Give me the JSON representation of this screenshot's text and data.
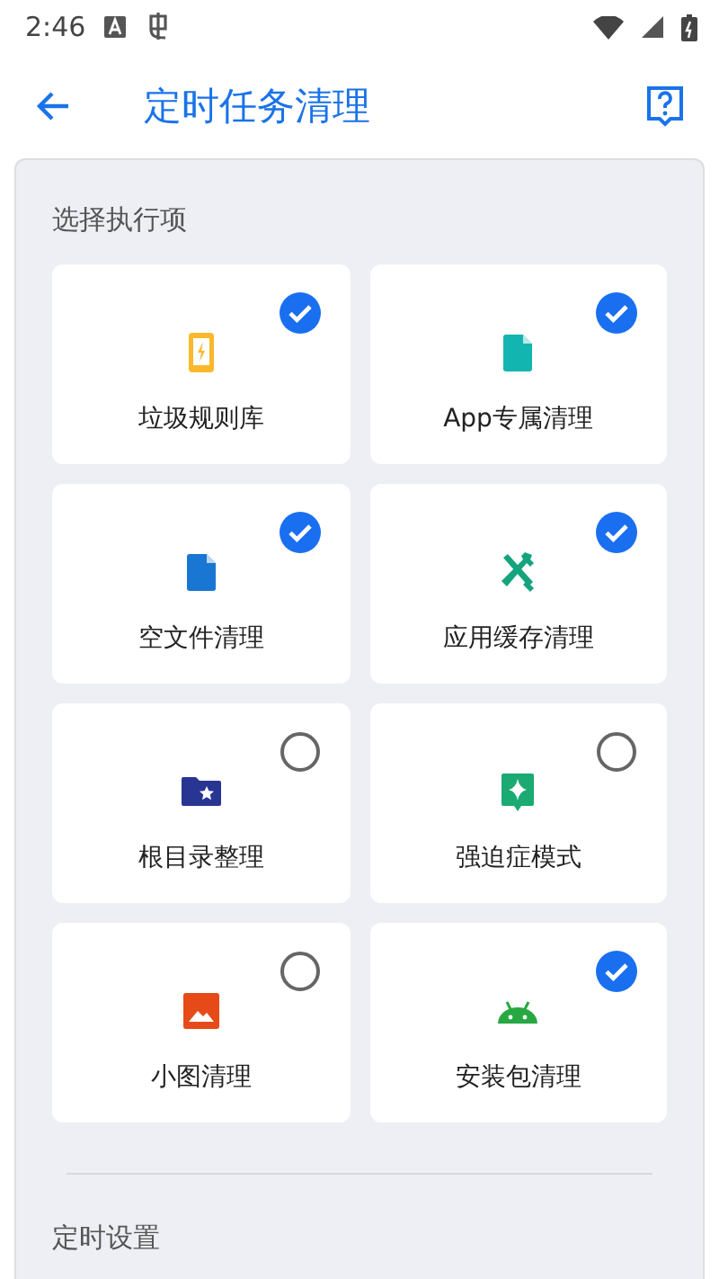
{
  "status_bar": {
    "time": "2:46"
  },
  "app_bar": {
    "title": "定时任务清理"
  },
  "sections": [
    {
      "title": "选择执行项"
    },
    {
      "title": "定时设置"
    }
  ],
  "items": [
    {
      "label": "垃圾规则库",
      "kind": "phone",
      "color": "#f9b92b",
      "checked": true
    },
    {
      "label": "App专属清理",
      "kind": "file",
      "color": "#12b5b0",
      "checked": true
    },
    {
      "label": "空文件清理",
      "kind": "file",
      "color": "#1976d2",
      "checked": true
    },
    {
      "label": "应用缓存清理",
      "kind": "tools",
      "color": "#14a37f",
      "checked": true
    },
    {
      "label": "根目录整理",
      "kind": "folder",
      "color": "#283593",
      "checked": false
    },
    {
      "label": "强迫症模式",
      "kind": "sparkle",
      "color": "#1aaa72",
      "checked": false
    },
    {
      "label": "小图清理",
      "kind": "image",
      "color": "#e64a19",
      "checked": false
    },
    {
      "label": "安装包清理",
      "kind": "android",
      "color": "#27a843",
      "checked": true
    }
  ]
}
